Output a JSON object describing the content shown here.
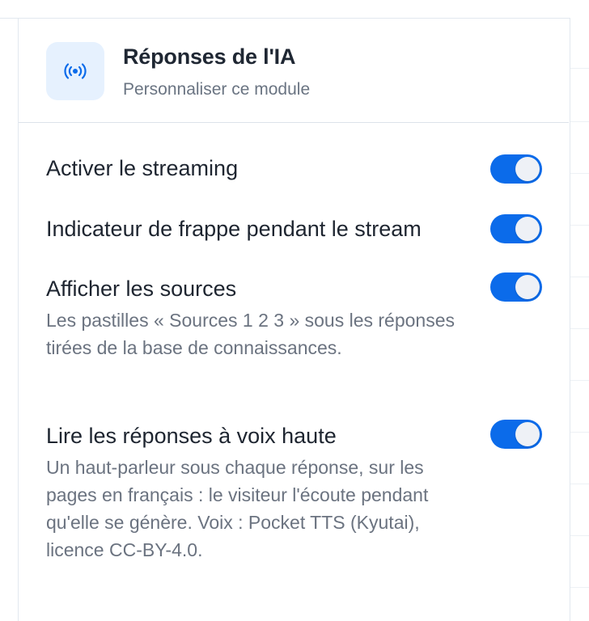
{
  "module": {
    "icon": "broadcast-icon",
    "title": "Réponses de l'IA",
    "subtitle": "Personnaliser ce module"
  },
  "settings": [
    {
      "label": "Activer le streaming",
      "description": "",
      "enabled": true
    },
    {
      "label": "Indicateur de frappe pendant le stream",
      "description": "",
      "enabled": true
    },
    {
      "label": "Afficher les sources",
      "description": "Les pastilles « Sources 1 2 3 » sous les réponses tirées de la base de connaissances.",
      "enabled": true
    },
    {
      "label": "Lire les réponses à voix haute",
      "description": "Un haut-parleur sous chaque réponse, sur les pages en français : le visiteur l'écoute pendant qu'elle se génère. Voix : Pocket TTS (Kyutai), licence CC-BY-4.0.",
      "enabled": true
    }
  ],
  "colors": {
    "accent": "#0b6bea",
    "icon_bg": "#e6f1fe",
    "title_text": "#1f2733",
    "muted_text": "#6b7380"
  }
}
